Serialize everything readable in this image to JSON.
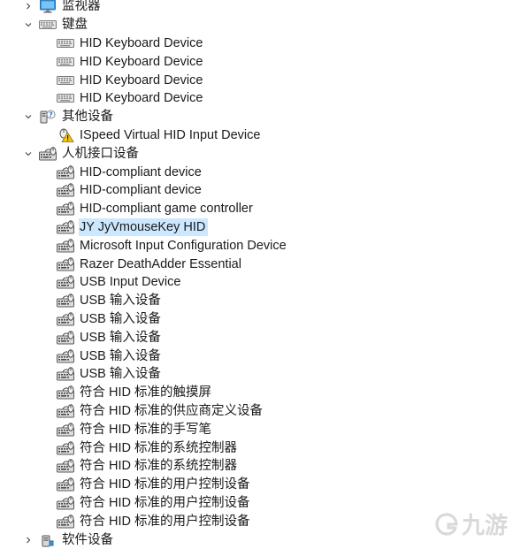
{
  "colors": {
    "selection": "#cce8ff",
    "text": "#1a1a1a",
    "watermark": "#d9d9d9"
  },
  "categories": [
    {
      "label": "监视器",
      "icon": "monitor-icon",
      "expanded": false,
      "devices": []
    },
    {
      "label": "键盘",
      "icon": "keyboard-icon",
      "expanded": true,
      "devices": [
        {
          "label": "HID Keyboard Device",
          "icon": "keyboard-icon"
        },
        {
          "label": "HID Keyboard Device",
          "icon": "keyboard-icon"
        },
        {
          "label": "HID Keyboard Device",
          "icon": "keyboard-icon"
        },
        {
          "label": "HID Keyboard Device",
          "icon": "keyboard-icon"
        }
      ]
    },
    {
      "label": "其他设备",
      "icon": "unknown-device-icon",
      "expanded": true,
      "devices": [
        {
          "label": "ISpeed Virtual HID Input Device",
          "icon": "warning-device-icon"
        }
      ]
    },
    {
      "label": "人机接口设备",
      "icon": "hid-icon",
      "expanded": true,
      "devices": [
        {
          "label": "HID-compliant device",
          "icon": "hid-icon"
        },
        {
          "label": "HID-compliant device",
          "icon": "hid-icon"
        },
        {
          "label": "HID-compliant game controller",
          "icon": "hid-icon"
        },
        {
          "label": "JY JyVmouseKey HID",
          "icon": "hid-icon",
          "selected": true
        },
        {
          "label": "Microsoft Input Configuration Device",
          "icon": "hid-icon"
        },
        {
          "label": "Razer DeathAdder Essential",
          "icon": "hid-icon"
        },
        {
          "label": "USB Input Device",
          "icon": "hid-icon"
        },
        {
          "label": "USB 输入设备",
          "icon": "hid-icon"
        },
        {
          "label": "USB 输入设备",
          "icon": "hid-icon"
        },
        {
          "label": "USB 输入设备",
          "icon": "hid-icon"
        },
        {
          "label": "USB 输入设备",
          "icon": "hid-icon"
        },
        {
          "label": "USB 输入设备",
          "icon": "hid-icon"
        },
        {
          "label": "符合 HID 标准的触摸屏",
          "icon": "hid-icon"
        },
        {
          "label": "符合 HID 标准的供应商定义设备",
          "icon": "hid-icon"
        },
        {
          "label": "符合 HID 标准的手写笔",
          "icon": "hid-icon"
        },
        {
          "label": "符合 HID 标准的系统控制器",
          "icon": "hid-icon"
        },
        {
          "label": "符合 HID 标准的系统控制器",
          "icon": "hid-icon"
        },
        {
          "label": "符合 HID 标准的用户控制设备",
          "icon": "hid-icon"
        },
        {
          "label": "符合 HID 标准的用户控制设备",
          "icon": "hid-icon"
        },
        {
          "label": "符合 HID 标准的用户控制设备",
          "icon": "hid-icon"
        }
      ]
    },
    {
      "label": "软件设备",
      "icon": "software-device-icon",
      "expanded": false,
      "devices": []
    }
  ],
  "watermark": {
    "text": "九游",
    "icon": "jiuyou-logo-icon"
  }
}
